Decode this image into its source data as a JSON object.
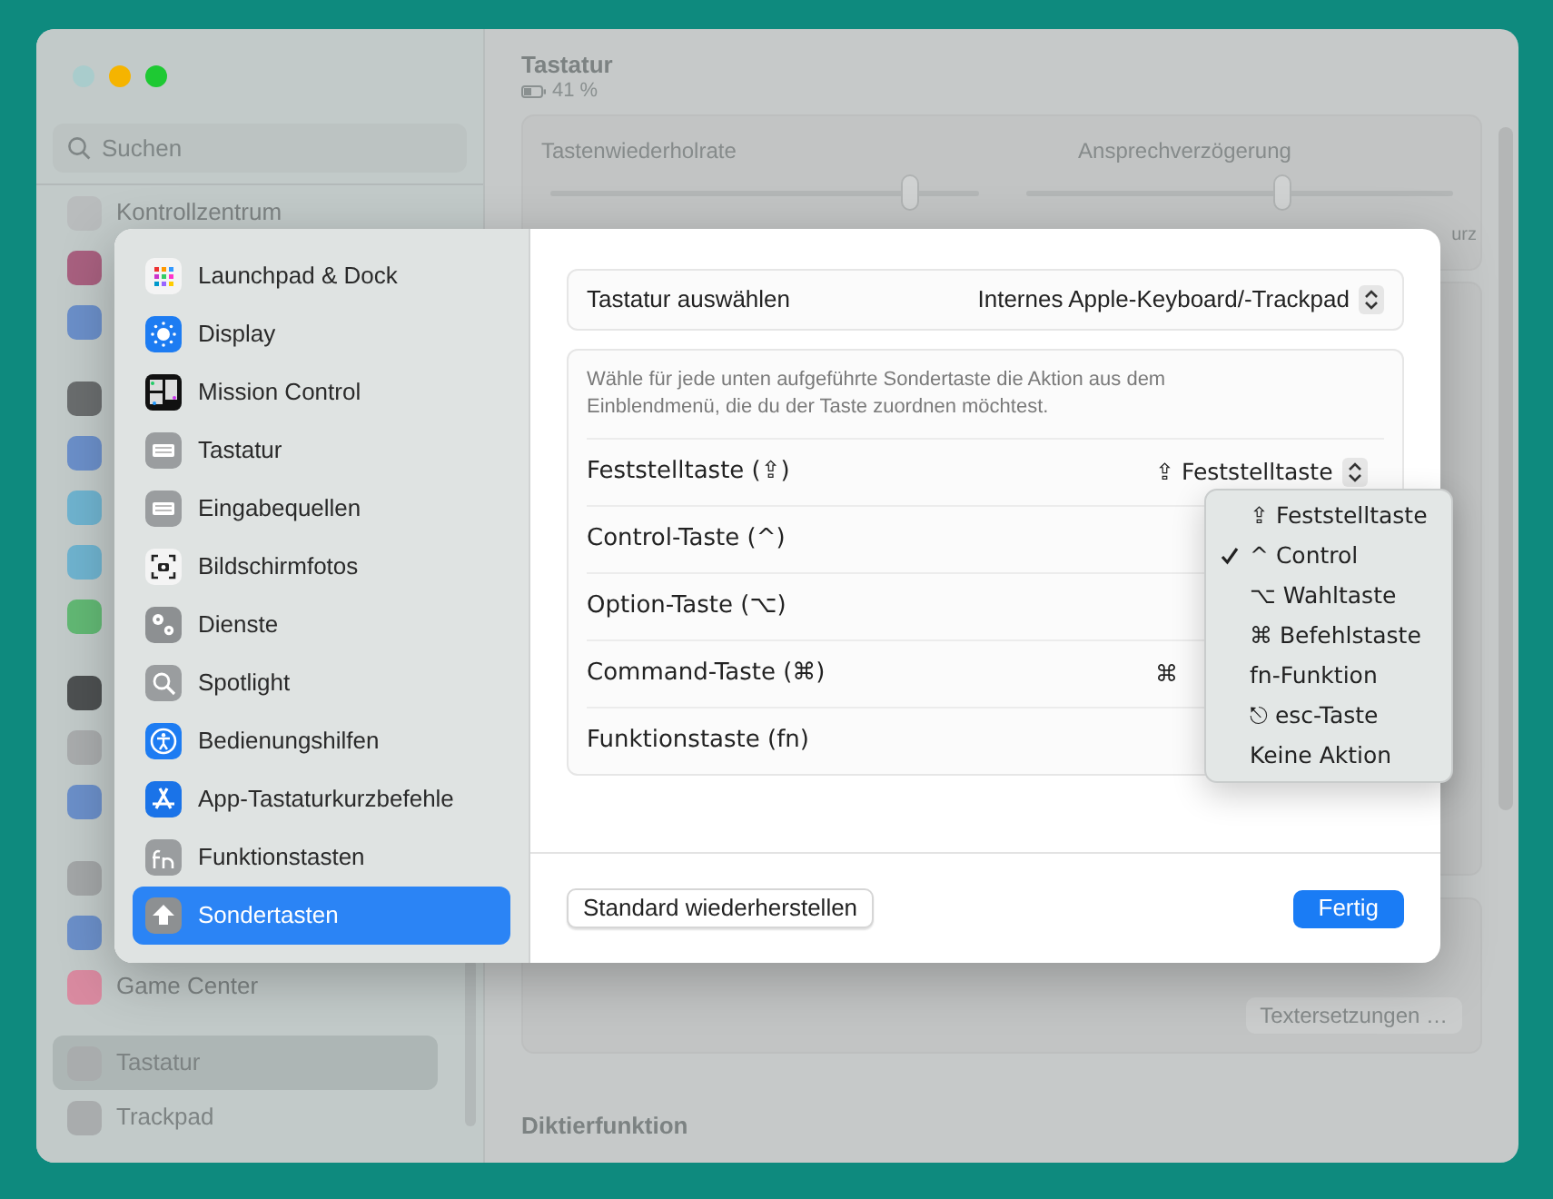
{
  "background": {
    "title": "Tastatur",
    "battery": "41 %",
    "search": {
      "placeholder": "Suchen"
    },
    "sidebar_groups": [
      [
        {
          "label": "Kontrollzentrum",
          "color": "#b9bcbd"
        },
        {
          "color": "#a8607f"
        },
        {
          "color": "#6b8fc9"
        }
      ],
      [
        {
          "color": "#6a6d6e"
        },
        {
          "color": "#6b8fc9"
        },
        {
          "color": "#6fb3cf"
        },
        {
          "color": "#6fb3cf"
        },
        {
          "color": "#62b874"
        }
      ],
      [
        {
          "color": "#4d5051"
        },
        {
          "color": "#a9acad"
        },
        {
          "color": "#6b8fc9"
        }
      ],
      [
        {
          "color": "#a3a6a7"
        },
        {
          "color": "#6b8fc9"
        },
        {
          "label": "Game Center",
          "color": "#d98aa0"
        }
      ],
      [
        {
          "label": "Tastatur",
          "color": "#a9acad",
          "selected": true
        },
        {
          "label": "Trackpad",
          "color": "#a9acad",
          "selected": false
        }
      ]
    ],
    "sliders": [
      {
        "label": "Tastenwiederholrate",
        "level": 0.84
      },
      {
        "label": "Ansprechverzögerung",
        "level": 0.6
      }
    ],
    "slider_end_label": "urz",
    "text_button": "Textersetzungen …",
    "section_heading": "Diktierfunktion"
  },
  "sheet": {
    "sidebar": [
      {
        "label": "Launchpad & Dock",
        "kind": "launchpad",
        "selected": false
      },
      {
        "label": "Display",
        "kind": "display",
        "selected": false
      },
      {
        "label": "Mission Control",
        "kind": "mission",
        "selected": false
      },
      {
        "label": "Tastatur",
        "kind": "keyboard",
        "selected": false
      },
      {
        "label": "Eingabequellen",
        "kind": "keyboard",
        "selected": false
      },
      {
        "label": "Bildschirmfotos",
        "kind": "screenshot",
        "selected": false
      },
      {
        "label": "Dienste",
        "kind": "gears",
        "selected": false
      },
      {
        "label": "Spotlight",
        "kind": "search",
        "selected": false
      },
      {
        "label": "Bedienungshilfen",
        "kind": "accessibility",
        "selected": false
      },
      {
        "label": "App-Tastaturkurzbefehle",
        "kind": "appstore",
        "selected": false
      },
      {
        "label": "Funktionstasten",
        "kind": "fn",
        "selected": false
      },
      {
        "label": "Sondertasten",
        "kind": "arrow",
        "selected": true
      }
    ],
    "keyboard_select": {
      "label": "Tastatur auswählen",
      "value": "Internes Apple-Keyboard/-Trackpad"
    },
    "description": "Wähle für jede unten aufgeführte Sondertaste die Aktion aus dem Einblendmenü, die du der Taste zuordnen möchtest.",
    "rows": [
      {
        "label": "Feststelltaste (⇪)",
        "value": "⇪ Feststelltaste",
        "kind": "popup"
      },
      {
        "label": "Control-Taste (^)"
      },
      {
        "label": "Option-Taste (⌥)"
      },
      {
        "label": "Command-Taste (⌘)",
        "value": "⌘",
        "kind": "covered"
      },
      {
        "label": "Funktionstaste (fn)"
      }
    ],
    "menu": [
      {
        "label": "⇪ Feststelltaste",
        "checked": false
      },
      {
        "label": "^ Control",
        "checked": true
      },
      {
        "label": "⌥ Wahltaste",
        "checked": false
      },
      {
        "label": "⌘ Befehlstaste",
        "checked": false
      },
      {
        "label": "fn-Funktion",
        "checked": false
      },
      {
        "label": "⎋ esc-Taste",
        "checked": false
      },
      {
        "label": "Keine Aktion",
        "checked": false
      }
    ],
    "buttons": {
      "reset": "Standard wiederherstellen",
      "done": "Fertig"
    }
  }
}
